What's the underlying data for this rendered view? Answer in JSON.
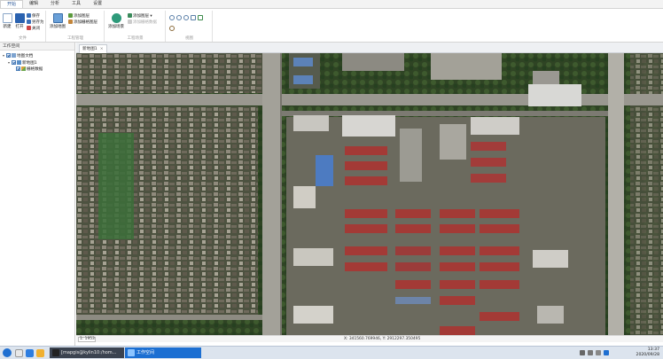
{
  "ribbon": {
    "tabs": [
      "开始",
      "编辑",
      "分析",
      "工具",
      "设置"
    ],
    "groups": {
      "file": {
        "label": "文件",
        "new": "新建",
        "open": "打开",
        "save": "保存",
        "save_as": "另存为",
        "close": "关闭"
      },
      "data": {
        "label": "工程管理",
        "add_map": "添加地图",
        "add_layer": "添加图层",
        "add_raster": "添加栅格图层"
      },
      "scene": {
        "label": "工程场景",
        "add_scene": "添加场景",
        "add_group": "添加图层",
        "add_terrain": "添加栅格数据"
      },
      "view": {
        "label": "视图"
      }
    }
  },
  "left_panel": {
    "title": "工作空间",
    "tree": [
      {
        "label": "地图文档",
        "level": 0
      },
      {
        "label": "新地图1",
        "level": 1
      },
      {
        "label": "栅格数据",
        "level": 2
      }
    ]
  },
  "document": {
    "tab_label": "新地图1",
    "close_glyph": "×"
  },
  "status": {
    "scale": "1: 1953",
    "coordinates": "X: 341560.769946,   Y: 2912297.350495"
  },
  "taskbar": {
    "tasks": [
      {
        "label": "[mapgis@kylin10:/hom...",
        "active": false
      },
      {
        "label": "工作空间",
        "active": true
      }
    ],
    "time": "13:37",
    "date": "2020/09/28"
  },
  "colors": {
    "accent": "#2b5797",
    "taskbar_active": "#1c6fd2",
    "taskbar_inactive": "#3b4350"
  }
}
